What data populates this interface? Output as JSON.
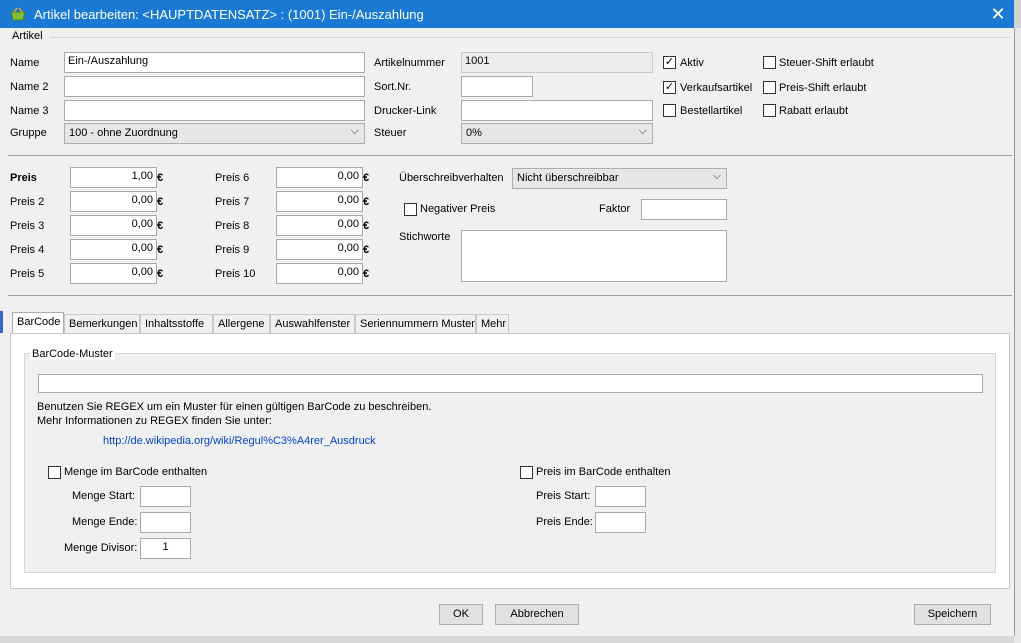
{
  "window": {
    "title": "Artikel bearbeiten: <HAUPTDATENSATZ> : (1001) Ein-/Auszahlung",
    "close_glyph": "✕"
  },
  "artikel": {
    "group_label": "Artikel",
    "name_label": "Name",
    "name_value": "Ein-/Auszahlung",
    "name2_label": "Name 2",
    "name2_value": "",
    "name3_label": "Name 3",
    "name3_value": "",
    "gruppe_label": "Gruppe",
    "gruppe_value": "100 - ohne Zuordnung",
    "artikelnummer_label": "Artikelnummer",
    "artikelnummer_value": "1001",
    "sortnr_label": "Sort.Nr.",
    "sortnr_value": "",
    "drucker_label": "Drucker-Link",
    "drucker_value": "",
    "steuer_label": "Steuer",
    "steuer_value": "0%",
    "checks": {
      "aktiv": {
        "label": "Aktiv",
        "checked": true
      },
      "verkauf": {
        "label": "Verkaufsartikel",
        "checked": true
      },
      "bestell": {
        "label": "Bestellartikel",
        "checked": false
      },
      "steuer_shift": {
        "label": "Steuer-Shift erlaubt",
        "checked": false
      },
      "preis_shift": {
        "label": "Preis-Shift erlaubt",
        "checked": false
      },
      "rabatt": {
        "label": "Rabatt erlaubt",
        "checked": false
      }
    }
  },
  "preise": {
    "currency": "€",
    "items": [
      {
        "label": "Preis",
        "value": "1,00"
      },
      {
        "label": "Preis 2",
        "value": "0,00"
      },
      {
        "label": "Preis 3",
        "value": "0,00"
      },
      {
        "label": "Preis 4",
        "value": "0,00"
      },
      {
        "label": "Preis 5",
        "value": "0,00"
      },
      {
        "label": "Preis 6",
        "value": "0,00"
      },
      {
        "label": "Preis 7",
        "value": "0,00"
      },
      {
        "label": "Preis 8",
        "value": "0,00"
      },
      {
        "label": "Preis 9",
        "value": "0,00"
      },
      {
        "label": "Preis 10",
        "value": "0,00"
      }
    ],
    "ueberschreib_label": "Überschreibverhalten",
    "ueberschreib_value": "Nicht überschreibbar",
    "negativ_label": "Negativer Preis",
    "faktor_label": "Faktor",
    "faktor_value": "",
    "stichworte_label": "Stichworte",
    "stichworte_value": ""
  },
  "tabs": [
    {
      "label": "BarCode",
      "active": true
    },
    {
      "label": "Bemerkungen",
      "active": false
    },
    {
      "label": "Inhaltsstoffe",
      "active": false
    },
    {
      "label": "Allergene",
      "active": false
    },
    {
      "label": "Auswahlfenster",
      "active": false
    },
    {
      "label": "Seriennummern Muster",
      "active": false
    },
    {
      "label": "Mehr",
      "active": false
    }
  ],
  "barcode": {
    "group_label": "BarCode-Muster",
    "muster_value": "",
    "info1": "Benutzen Sie REGEX um ein Muster für einen gültigen BarCode zu beschreiben.",
    "info2": "Mehr Informationen zu REGEX finden Sie unter:",
    "link": "http://de.wikipedia.org/wiki/Regul%C3%A4rer_Ausdruck",
    "menge_check_label": "Menge im BarCode enthalten",
    "menge_start_label": "Menge Start:",
    "menge_start_value": "",
    "menge_ende_label": "Menge Ende:",
    "menge_ende_value": "",
    "menge_divisor_label": "Menge Divisor:",
    "menge_divisor_value": "1",
    "preis_check_label": "Preis im BarCode enthalten",
    "preis_start_label": "Preis Start:",
    "preis_start_value": "",
    "preis_ende_label": "Preis Ende:",
    "preis_ende_value": ""
  },
  "buttons": {
    "ok": "OK",
    "abbrechen": "Abbrechen",
    "speichern": "Speichern"
  }
}
